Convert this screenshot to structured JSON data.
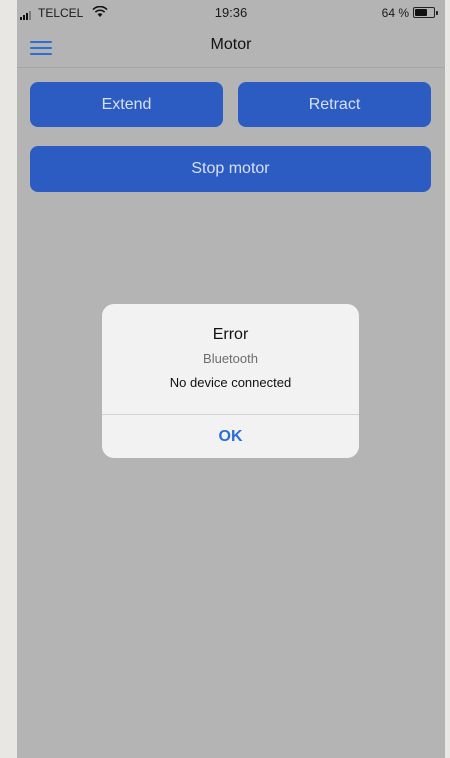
{
  "status_bar": {
    "carrier": "TELCEL",
    "time": "19:36",
    "battery": "64 %",
    "battery_level": 0.64,
    "icons": [
      "signal-icon",
      "wifi-icon",
      "battery-icon"
    ]
  },
  "nav": {
    "title": "Motor",
    "menu_icon": "hamburger-menu-icon"
  },
  "buttons": {
    "extend": "Extend",
    "retract": "Retract",
    "stop": "Stop motor"
  },
  "dialog": {
    "title": "Error",
    "subtitle": "Bluetooth",
    "message": "No device connected",
    "ok": "OK"
  },
  "colors": {
    "accent": "#2b6fd6",
    "button_bg": "#2c5cc2",
    "overlay_bg": "#b4b4b4",
    "dialog_bg": "#f2f2f2"
  }
}
